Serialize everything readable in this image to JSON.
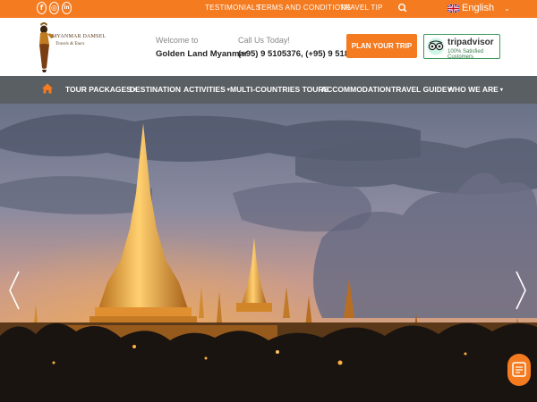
{
  "topbar": {
    "social": [
      {
        "icon": "facebook-icon",
        "glyph": "f"
      },
      {
        "icon": "instagram-icon",
        "glyph": "◎"
      },
      {
        "icon": "linkedin-icon",
        "glyph": "in"
      }
    ],
    "links": [
      "TESTIMONIALS",
      "TERMS AND CONDITIONS",
      "TRAVEL TIP"
    ],
    "search_icon": "search-icon",
    "language": {
      "label": "English",
      "flag": "uk-flag-icon"
    }
  },
  "header": {
    "logo": {
      "line1": "MYANMAR DAMSEL",
      "line2": "Travels & Tours"
    },
    "welcome": {
      "label": "Welcome to",
      "name": "Golden Land Myanmar"
    },
    "call": {
      "label": "Call Us Today!",
      "numbers": "(+95) 9 5105376, (+95) 9 5185581"
    },
    "plan_button": "PLAN YOUR TRIP",
    "tripadvisor": {
      "title": "tripadvisor",
      "subtitle": "100% Satisfied Customers"
    }
  },
  "nav": {
    "home_icon": "home-icon",
    "items": [
      {
        "label": "TOUR PACKAGES",
        "has_dropdown": true
      },
      {
        "label": "DESTINATION",
        "has_dropdown": false
      },
      {
        "label": "ACTIVITIES",
        "has_dropdown": true
      },
      {
        "label": "MULTI-COUNTRIES TOURS",
        "has_dropdown": false
      },
      {
        "label": "ACCOMMODATION",
        "has_dropdown": false
      },
      {
        "label": "TRAVEL GUIDE",
        "has_dropdown": true
      },
      {
        "label": "WHO WE ARE",
        "has_dropdown": true
      }
    ]
  },
  "hero": {
    "prev_icon": "chevron-left-icon",
    "next_icon": "chevron-right-icon",
    "chat_icon": "chat-icon"
  },
  "colors": {
    "accent": "#f47b20",
    "nav_bg": "#5a5f63"
  }
}
